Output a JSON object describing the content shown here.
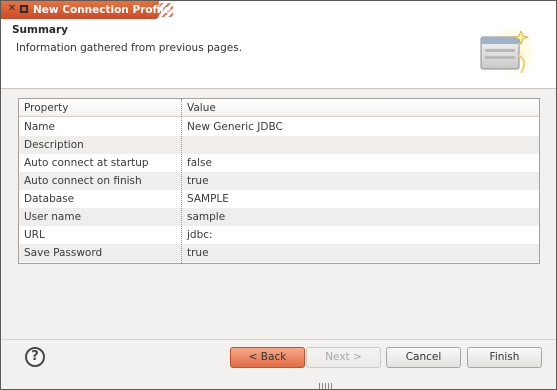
{
  "window": {
    "title": "New Connection Profile",
    "close_icon": "close-icon",
    "maximize_icon": "maximize-icon"
  },
  "header": {
    "title": "Summary",
    "description": "Information gathered from previous pages.",
    "icon": "connection-wizard-icon"
  },
  "table": {
    "columns": [
      "Property",
      "Value"
    ],
    "rows": [
      {
        "property": "Name",
        "value": "New Generic JDBC"
      },
      {
        "property": "Description",
        "value": ""
      },
      {
        "property": "Auto connect at startup",
        "value": "false"
      },
      {
        "property": "Auto connect on finish",
        "value": "true"
      },
      {
        "property": "Database",
        "value": "SAMPLE"
      },
      {
        "property": "User name",
        "value": "sample"
      },
      {
        "property": "URL",
        "value": "jdbc:"
      },
      {
        "property": "Save Password",
        "value": "true"
      }
    ]
  },
  "footer": {
    "help_label": "?",
    "back_label": "< Back",
    "next_label": "Next >",
    "cancel_label": "Cancel",
    "finish_label": "Finish"
  },
  "colors": {
    "accent": "#e46c44",
    "title_bar": "#d35a32"
  }
}
